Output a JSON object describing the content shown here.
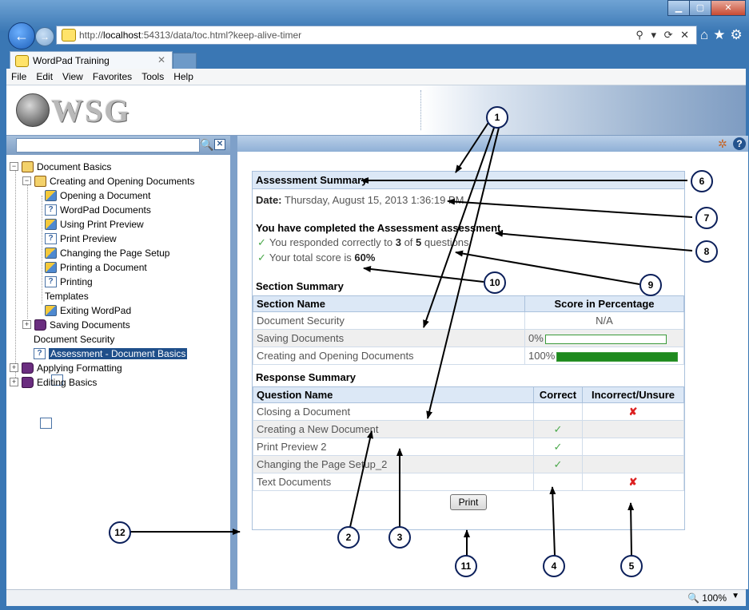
{
  "browser": {
    "url_prefix": "http://",
    "url_host": "localhost",
    "url_rest": ":54313/data/toc.html?keep-alive-timer",
    "addr_controls": "⚲ ▾ ⟳ ✕",
    "tab_title": "WordPad Training"
  },
  "menu": [
    "File",
    "Edit",
    "View",
    "Favorites",
    "Tools",
    "Help"
  ],
  "banner": {
    "logo_text": "WSG"
  },
  "tree": {
    "items": [
      {
        "label": "Document Basics"
      },
      {
        "label": "Creating and Opening Documents"
      },
      {
        "label": "Opening a Document"
      },
      {
        "label": "WordPad Documents"
      },
      {
        "label": "Using Print Preview"
      },
      {
        "label": "Print Preview"
      },
      {
        "label": "Changing the Page Setup"
      },
      {
        "label": "Printing a Document"
      },
      {
        "label": "Printing"
      },
      {
        "label": "Templates"
      },
      {
        "label": "Exiting WordPad"
      },
      {
        "label": "Saving Documents"
      },
      {
        "label": "Document Security"
      },
      {
        "label": "Assessment - Document Basics"
      },
      {
        "label": "Applying Formatting"
      },
      {
        "label": "Editing Basics"
      }
    ]
  },
  "assessment": {
    "title": "Assessment Summary",
    "date_label": "Date:",
    "date_value": "Thursday, August 15, 2013 1:36:19 PM",
    "completed_text": "You have completed the Assessment assessment.",
    "resp_pre": "You responded correctly to",
    "resp_correct": "3",
    "resp_mid": "of",
    "resp_total": "5",
    "resp_post": "questions.",
    "score_pre": "Your total score is",
    "score_value": "60%",
    "section_summary_label": "Section Summary",
    "section_cols": [
      "Section Name",
      "Score in Percentage"
    ],
    "sections": [
      {
        "name": "Document Security",
        "score": "N/A"
      },
      {
        "name": "Saving Documents",
        "score": "0%",
        "progress": 0
      },
      {
        "name": "Creating and Opening Documents",
        "score": "100%",
        "progress": 1
      }
    ],
    "response_summary_label": "Response Summary",
    "response_cols": [
      "Question Name",
      "Correct",
      "Incorrect/Unsure"
    ],
    "responses": [
      {
        "name": "Closing a Document",
        "correct": "",
        "incorrect": "✘"
      },
      {
        "name": "Creating a New Document",
        "correct": "✓",
        "incorrect": ""
      },
      {
        "name": "Print Preview 2",
        "correct": "✓",
        "incorrect": ""
      },
      {
        "name": "Changing the Page Setup_2",
        "correct": "✓",
        "incorrect": ""
      },
      {
        "name": "Text Documents",
        "correct": "",
        "incorrect": "✘"
      }
    ],
    "print_label": "Print"
  },
  "statusbar": {
    "zoom": "100%"
  },
  "callouts": [
    "1",
    "2",
    "3",
    "4",
    "5",
    "6",
    "7",
    "8",
    "9",
    "10",
    "11",
    "12"
  ]
}
